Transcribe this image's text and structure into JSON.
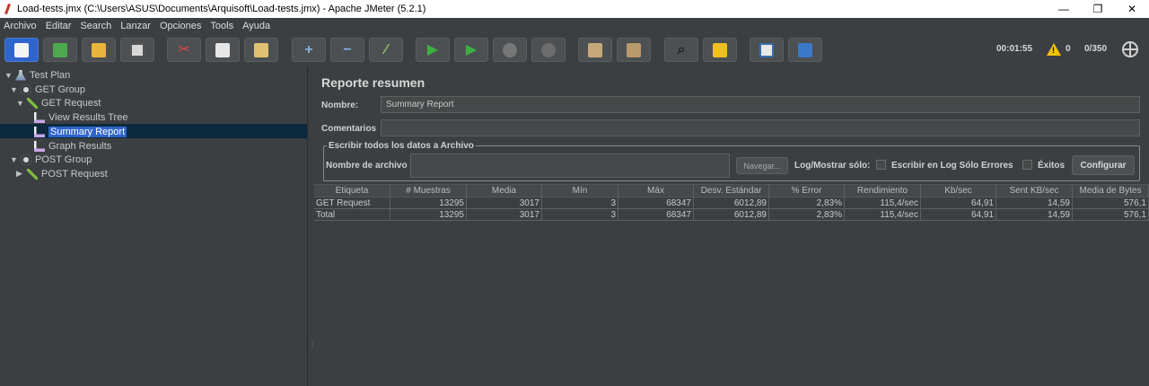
{
  "window": {
    "title": "Load-tests.jmx (C:\\Users\\ASUS\\Documents\\Arquisoft\\Load-tests.jmx) - Apache JMeter (5.2.1)",
    "minimize": "—",
    "maximize": "❐",
    "close": "✕"
  },
  "menu": [
    "Archivo",
    "Editar",
    "Search",
    "Lanzar",
    "Opciones",
    "Tools",
    "Ayuda"
  ],
  "toolbar": {
    "icons": [
      "new-template-icon",
      "templates-icon",
      "open-icon",
      "save-icon",
      "cut-icon",
      "copy-icon",
      "paste-icon",
      "expand-icon",
      "collapse-icon",
      "toggle-icon",
      "start-icon",
      "start-no-timers-icon",
      "stop-icon",
      "shutdown-icon",
      "clear-icon",
      "clear-all-icon",
      "search-icon",
      "reset-search-icon",
      "function-helper-icon",
      "help-icon"
    ],
    "elapsed_time": "00:01:55",
    "warning_count": "0",
    "threads": "0/350"
  },
  "tree": {
    "test_plan": "Test Plan",
    "get_group": "GET Group",
    "get_request": "GET Request",
    "view_results_tree": "View Results Tree",
    "summary_report": "Summary Report",
    "graph_results": "Graph Results",
    "post_group": "POST Group",
    "post_request": "POST Request"
  },
  "panel": {
    "title": "Reporte resumen",
    "name_label": "Nombre:",
    "name_value": "Summary Report",
    "comments_label": "Comentarios",
    "comments_value": "",
    "fieldset_legend": "Escribir todos los datos a Archivo",
    "filename_label": "Nombre de archivo",
    "filename_value": "",
    "browse_button": "Navegar...",
    "log_show_label": "Log/Mostrar sólo:",
    "errors_checkbox_label": "Escribir en Log Sólo Errores",
    "success_checkbox_label": "Éxitos",
    "configure_button": "Configurar"
  },
  "table": {
    "headers": [
      "Etiqueta",
      "# Muestras",
      "Media",
      "Mín",
      "Máx",
      "Desv. Estándar",
      "% Error",
      "Rendimiento",
      "Kb/sec",
      "Sent KB/sec",
      "Media de Bytes"
    ],
    "rows": [
      [
        "GET Request",
        "13295",
        "3017",
        "3",
        "68347",
        "6012,89",
        "2,83%",
        "115,4/sec",
        "64,91",
        "14,59",
        "576,1"
      ],
      [
        "Total",
        "13295",
        "3017",
        "3",
        "68347",
        "6012,89",
        "2,83%",
        "115,4/sec",
        "64,91",
        "14,59",
        "576,1"
      ]
    ]
  }
}
